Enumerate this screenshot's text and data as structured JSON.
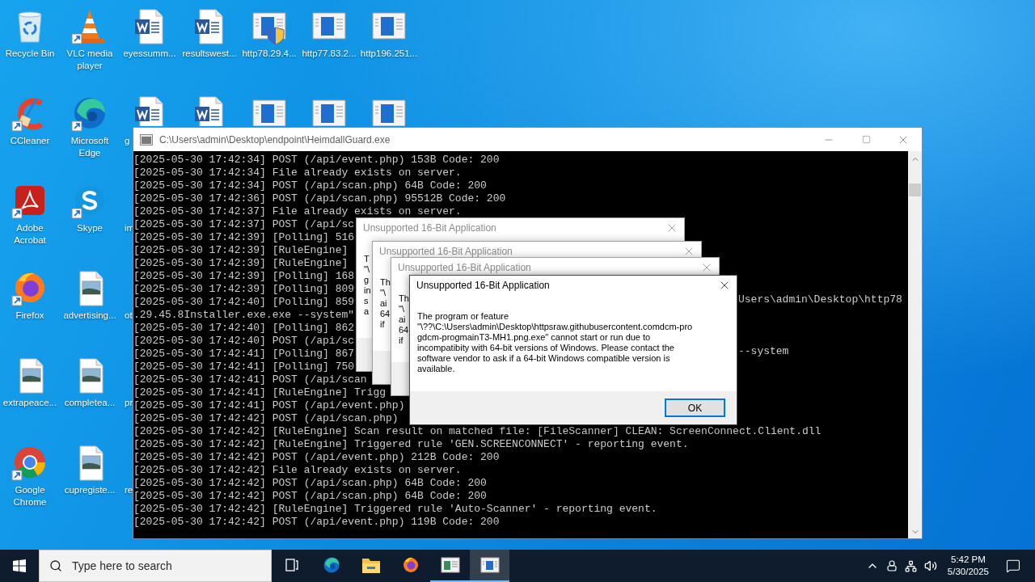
{
  "desktop": {
    "columns": [
      [
        {
          "kind": "recycle",
          "label": "Recycle Bin",
          "shortcut": false
        },
        {
          "kind": "ccleaner",
          "label": "CCleaner",
          "shortcut": true
        },
        {
          "kind": "acrobat",
          "label": "Adobe Acrobat",
          "shortcut": true
        },
        {
          "kind": "firefox",
          "label": "Firefox",
          "shortcut": true
        },
        {
          "kind": "image",
          "label": "extrapeace...",
          "shortcut": false
        },
        {
          "kind": "chrome",
          "label": "Google Chrome",
          "shortcut": true
        }
      ],
      [
        {
          "kind": "vlc",
          "label": "VLC media player",
          "shortcut": true
        },
        {
          "kind": "edge",
          "label": "Microsoft Edge",
          "shortcut": true
        },
        {
          "kind": "skype",
          "label": "Skype",
          "shortcut": true
        },
        {
          "kind": "image",
          "label": "advertising...",
          "shortcut": false
        },
        {
          "kind": "image",
          "label": "completea...",
          "shortcut": false
        },
        {
          "kind": "image",
          "label": "cupregiste...",
          "shortcut": false
        }
      ],
      [
        {
          "kind": "word",
          "label": "eyessumm...",
          "shortcut": false
        },
        {
          "kind": "word",
          "label": "g",
          "label_cut": true,
          "shortcut": false
        },
        {
          "kind": "hidden",
          "label": "im",
          "label_cut": true
        },
        {
          "kind": "hidden",
          "label": "ot",
          "label_cut": true
        },
        {
          "kind": "hidden",
          "label": "pr",
          "label_cut": true
        },
        {
          "kind": "hidden",
          "label": "re",
          "label_cut": true
        }
      ],
      [
        {
          "kind": "word",
          "label": "resultswest...",
          "shortcut": false
        },
        {
          "kind": "word",
          "shortcut": false
        }
      ],
      [
        {
          "kind": "installer",
          "label": "http78.29.4...",
          "shortcut": false
        },
        {
          "kind": "window",
          "shortcut": false
        }
      ],
      [
        {
          "kind": "window",
          "label": "http77.83.2...",
          "shortcut": false
        },
        {
          "kind": "window",
          "shortcut": false
        }
      ],
      [
        {
          "kind": "window",
          "label": "http196.251...",
          "shortcut": false
        },
        {
          "kind": "window",
          "shortcut": false
        }
      ]
    ]
  },
  "console_window": {
    "title": "C:\\Users\\admin\\Desktop\\endpoint\\HeimdallGuard.exe",
    "lines": [
      {
        "text": "[2025-05-30 17:42:34] POST (/api/event.php) 153B Code: 200"
      },
      {
        "text": "[2025-05-30 17:42:34] File already exists on server."
      },
      {
        "text": "[2025-05-30 17:42:34] POST (/api/scan.php) 64B Code: 200"
      },
      {
        "text": "[2025-05-30 17:42:36] POST (/api/scan.php) 95512B Code: 200"
      },
      {
        "text": "[2025-05-30 17:42:37] File already exists on server."
      },
      {
        "text": "[2025-05-30 17:42:37] POST (/api/sc"
      },
      {
        "text": "[2025-05-30 17:42:39] [Polling] 516"
      },
      {
        "text": "[2025-05-30 17:42:39] [RuleEngine]"
      },
      {
        "text": "[2025-05-30 17:42:39] [RuleEngine]"
      },
      {
        "text": "[2025-05-30 17:42:39] [Polling] 168"
      },
      {
        "text": "[2025-05-30 17:42:39] [Polling] 809"
      },
      {
        "text": "[2025-05-30 17:42:40] [Polling] 859",
        "tail": "Users\\admin\\Desktop\\http78"
      },
      {
        "text": ".29.45.8Installer.exe.exe --system\""
      },
      {
        "text": "[2025-05-30 17:42:40] [Polling] 862"
      },
      {
        "text": "[2025-05-30 17:42:40] POST (/api/sc"
      },
      {
        "text": "[2025-05-30 17:42:41] [Polling] 867",
        "tail": "--system"
      },
      {
        "text": "[2025-05-30 17:42:41] [Polling] 750"
      },
      {
        "text": "[2025-05-30 17:42:41] POST (/api/scan"
      },
      {
        "text": "[2025-05-30 17:42:41] [RuleEngine] Trigg"
      },
      {
        "text": "[2025-05-30 17:42:41] POST (/api/event.php)"
      },
      {
        "text": "[2025-05-30 17:42:42] POST (/api/scan.php)"
      },
      {
        "text": "[2025-05-30 17:42:42] [RuleEngine] Scan result on matched file: [FileScanner] CLEAN: ScreenConnect.Client.dll"
      },
      {
        "text": "[2025-05-30 17:42:42] [RuleEngine] Triggered rule 'GEN.SCREENCONNECT' - reporting event."
      },
      {
        "text": "[2025-05-30 17:42:42] POST (/api/event.php) 212B Code: 200"
      },
      {
        "text": "[2025-05-30 17:42:42] File already exists on server."
      },
      {
        "text": "[2025-05-30 17:42:42] POST (/api/scan.php) 64B Code: 200"
      },
      {
        "text": "[2025-05-30 17:42:42] POST (/api/scan.php) 64B Code: 200"
      },
      {
        "text": "[2025-05-30 17:42:42] [RuleEngine] Triggered rule 'Auto-Scanner' - reporting event."
      },
      {
        "text": "[2025-05-30 17:42:42] POST (/api/event.php) 119B Code: 200"
      }
    ]
  },
  "dialogs": [
    {
      "title": "Unsupported 16-Bit Application",
      "active": false,
      "lines": [
        "T",
        "\"\\",
        "g",
        "in",
        "s",
        "a"
      ]
    },
    {
      "title": "Unsupported 16-Bit Application",
      "active": false,
      "lines": [
        "Th",
        "\"\\",
        "ai",
        "64",
        "if"
      ]
    },
    {
      "title": "Unsupported 16-Bit Application",
      "active": false,
      "lines": [
        "Th",
        "\"\\",
        "ai",
        "64",
        "if"
      ]
    },
    {
      "title": "Unsupported 16-Bit Application",
      "active": true,
      "lines": [
        "The program or feature",
        "\"\\??\\C:\\Users\\admin\\Desktop\\httpsraw.githubusercontent.comdcm-pro",
        "gdcm-progmainT3-MH1.png.exe\" cannot start or run due to",
        "incompatibity with 64-bit versions of Windows. Please contact the",
        "software vendor to ask if a 64-bit Windows compatible version is",
        "available."
      ],
      "button": "OK"
    }
  ],
  "taskbar": {
    "search": {
      "placeholder": "Type here to search"
    },
    "apps": [
      {
        "kind": "task-view",
        "running": false,
        "active": false
      },
      {
        "kind": "edge",
        "running": false,
        "active": false
      },
      {
        "kind": "explorer",
        "running": false,
        "active": false
      },
      {
        "kind": "firefox",
        "running": false,
        "active": false
      },
      {
        "kind": "app",
        "running": true,
        "active": false
      },
      {
        "kind": "console",
        "running": true,
        "active": true
      }
    ],
    "clock": {
      "time": "5:42 PM",
      "date": "5/30/2025"
    }
  }
}
